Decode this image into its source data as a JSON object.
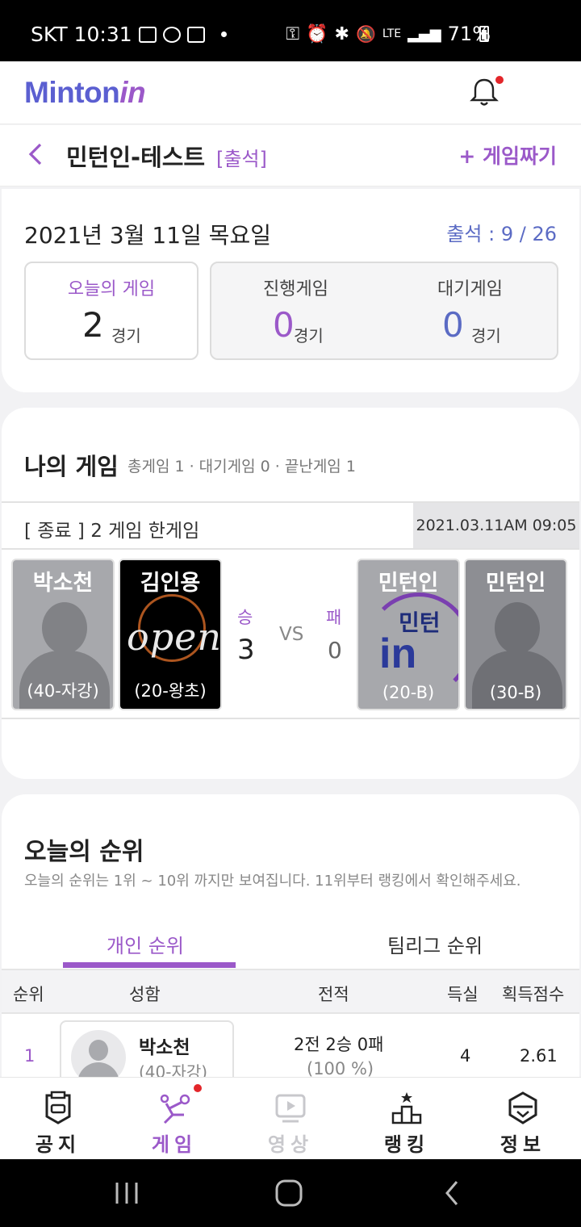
{
  "status_bar": {
    "carrier": "SKT",
    "time": "10:31",
    "battery": "71%",
    "network": "LTE"
  },
  "app_header": {
    "logo_main": "Minton",
    "logo_accent": "in"
  },
  "title_bar": {
    "title": "민턴인-테스트",
    "tag": "[출석]",
    "action": "+ 게임짜기"
  },
  "summary": {
    "date": "2021년 3월 11일 목요일",
    "attendance": "출석 : 9 / 26",
    "today": {
      "label": "오늘의 게임",
      "value": "2",
      "unit": "경기"
    },
    "in_progress": {
      "label": "진행게임",
      "value": "0",
      "unit": "경기"
    },
    "waiting": {
      "label": "대기게임",
      "value": "0",
      "unit": "경기"
    }
  },
  "my_game": {
    "title": "나의 게임",
    "subtitle": "총게임 1 · 대기게임 0 · 끝난게임 1",
    "match": {
      "status": "[ 종료 ]  2 게임  한게임",
      "time": "2021.03.11AM 09:05",
      "win_label": "승",
      "win_score": "3",
      "vs": "VS",
      "lose_label": "패",
      "lose_score": "0",
      "players": [
        {
          "name": "박소천",
          "level": "(40-자강)"
        },
        {
          "name": "김인용",
          "level": "(20-왕초)",
          "photo_text": "open"
        },
        {
          "name": "민턴인",
          "level": "(20-B)",
          "logo_text": "민턴",
          "logo_in": "in"
        },
        {
          "name": "민턴인",
          "level": "(30-B)"
        }
      ]
    }
  },
  "ranking": {
    "title": "오늘의 순위",
    "description": "오늘의 순위는 1위 ~ 10위 까지만 보여집니다. 11위부터 랭킹에서 확인해주세요.",
    "tabs": [
      "개인 순위",
      "팀리그 순위"
    ],
    "headers": [
      "순위",
      "성함",
      "전적",
      "득실",
      "획득점수"
    ],
    "rows": [
      {
        "rank": "1",
        "name": "박소천",
        "level": "(40-자강)",
        "record": "2전 2승 0패",
        "rate": "(100 %)",
        "diff": "4",
        "score": "2.61"
      }
    ]
  },
  "bottom_nav": [
    {
      "label": "공지",
      "icon": "notice-shield-icon"
    },
    {
      "label": "게임",
      "icon": "badminton-player-icon"
    },
    {
      "label": "영상",
      "icon": "video-play-icon"
    },
    {
      "label": "랭킹",
      "icon": "podium-icon"
    },
    {
      "label": "정보",
      "icon": "info-shield-icon"
    }
  ],
  "colors": {
    "accent": "#9b59c9",
    "brand_blue": "#5b5fd1",
    "stat_blue": "#5b6bc4",
    "notification": "#e3262a"
  }
}
